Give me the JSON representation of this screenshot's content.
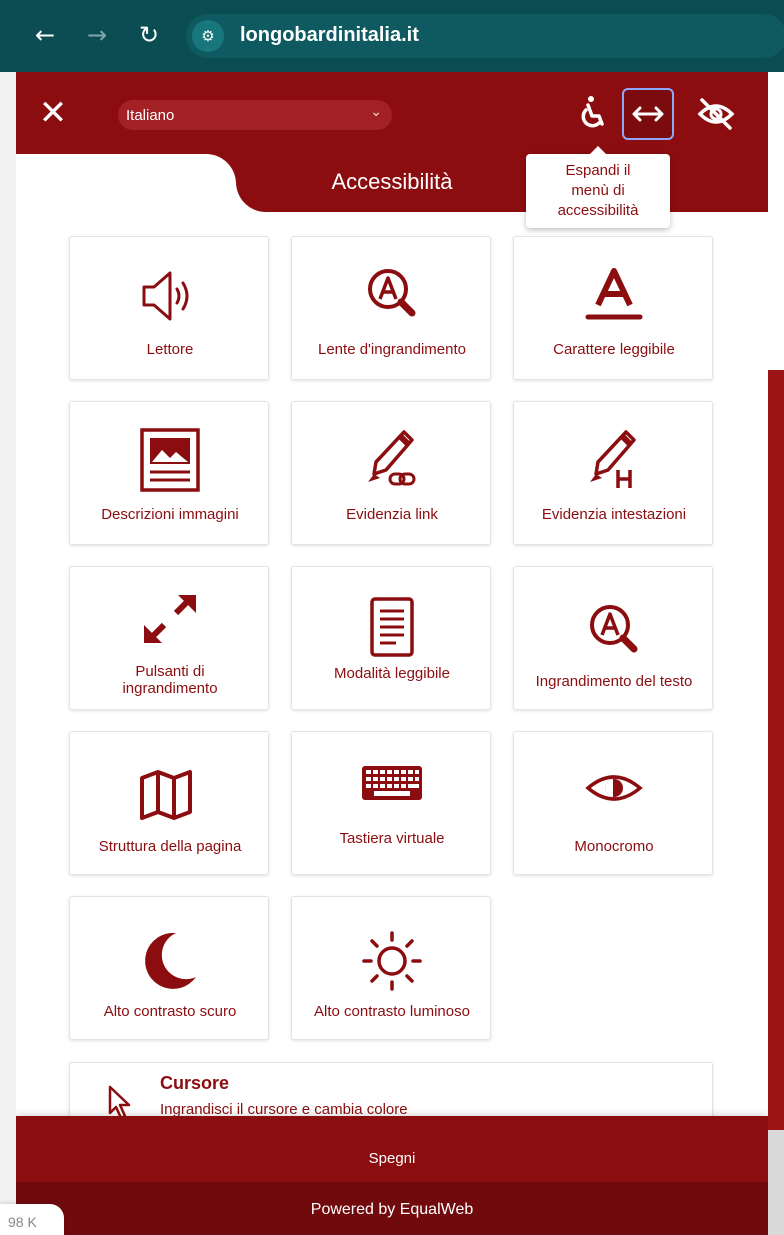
{
  "browser": {
    "url": "longobardinitalia.it"
  },
  "panel": {
    "language": "Italiano",
    "title": "Accessibilità",
    "tooltip": [
      "Espandi il",
      "menù di",
      "accessibilità"
    ]
  },
  "tiles": [
    {
      "label": "Lettore",
      "icon": "speaker-icon"
    },
    {
      "label": "Lente d'ingrandimento",
      "icon": "magnifier-a-icon"
    },
    {
      "label": "Carattere leggibile",
      "icon": "letter-a-icon"
    },
    {
      "label": "Descrizioni immagini",
      "icon": "image-description-icon"
    },
    {
      "label": "Evidenzia link",
      "icon": "highlighter-link-icon"
    },
    {
      "label": "Evidenzia intestazioni",
      "icon": "highlighter-h-icon"
    },
    {
      "label": "Pulsanti di\ningrandimento",
      "icon": "expand-arrows-icon"
    },
    {
      "label": "Modalità leggibile",
      "icon": "document-icon"
    },
    {
      "label": "Ingrandimento del testo",
      "icon": "magnifier-a-icon"
    },
    {
      "label": "Struttura della pagina",
      "icon": "map-icon"
    },
    {
      "label": "Tastiera virtuale",
      "icon": "keyboard-icon"
    },
    {
      "label": "Monocromo",
      "icon": "eye-icon"
    },
    {
      "label": "Alto contrasto scuro",
      "icon": "moon-icon"
    },
    {
      "label": "Alto contrasto luminoso",
      "icon": "sun-icon"
    }
  ],
  "cursor": {
    "title": "Cursore",
    "description": "Ingrandisci il cursore e cambia colore"
  },
  "footer": {
    "off": "Spegni",
    "powered": "Powered by EqualWeb"
  },
  "corner": "98 K",
  "colors": {
    "brand": "#8b0d10",
    "browser": "#0b4d52"
  }
}
